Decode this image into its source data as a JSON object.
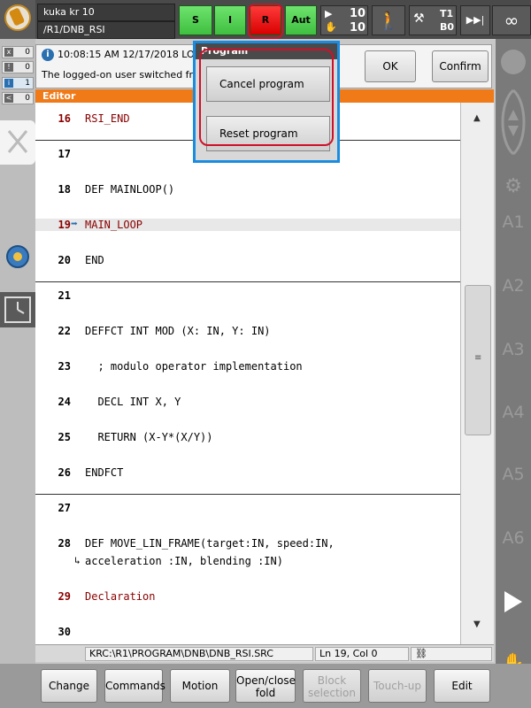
{
  "header": {
    "robot_name": "kuka kr 10",
    "path": "/R1/DNB_RSI",
    "status_buttons": [
      {
        "label": "S",
        "state": "green"
      },
      {
        "label": "I",
        "state": "green"
      },
      {
        "label": "R",
        "state": "red"
      },
      {
        "label": "Aut",
        "state": "green"
      }
    ],
    "override_prog": "10",
    "override_jog": "10",
    "tool_label": "T1",
    "base_label": "B0",
    "infinity": "∞"
  },
  "counters": [
    {
      "icon": "x",
      "value": "0"
    },
    {
      "icon": "!",
      "value": "0"
    },
    {
      "icon": "i",
      "value": "1"
    },
    {
      "icon": "<",
      "value": "0"
    }
  ],
  "message": {
    "time": "10:08:15 AM 12/17/2018 LO",
    "text": "The logged-on user switched fro",
    "ok_label": "OK",
    "confirm_all_label": "Confirm all"
  },
  "editor": {
    "title": "Editor",
    "lines": [
      {
        "num": "16",
        "code": "RSI_END",
        "style": "red"
      },
      {
        "num": "17",
        "code": "",
        "style": "plain"
      },
      {
        "num": "18",
        "code": "DEF MAINLOOP()",
        "style": "plain"
      },
      {
        "num": "19",
        "code": "MAIN_LOOP",
        "style": "red"
      },
      {
        "num": "20",
        "code": "END",
        "style": "plain"
      },
      {
        "num": "21",
        "code": "",
        "style": "plain"
      },
      {
        "num": "22",
        "code": "DEFFCT INT MOD (X: IN, Y: IN)",
        "style": "plain"
      },
      {
        "num": "23",
        "code": "  ; modulo operator implementation",
        "style": "plain"
      },
      {
        "num": "24",
        "code": "  DECL INT X, Y",
        "style": "plain"
      },
      {
        "num": "25",
        "code": "  RETURN (X-Y*(X/Y))",
        "style": "plain"
      },
      {
        "num": "26",
        "code": "ENDFCT",
        "style": "plain"
      },
      {
        "num": "27",
        "code": "",
        "style": "plain"
      },
      {
        "num": "28",
        "code": "DEF MOVE_LIN_FRAME(target:IN, speed:IN,",
        "style": "plain"
      },
      {
        "num": "",
        "code": "acceleration :IN, blending :IN)",
        "style": "plain"
      },
      {
        "num": "29",
        "code": "Declaration",
        "style": "red"
      },
      {
        "num": "30",
        "code": "",
        "style": "plain"
      }
    ]
  },
  "statusbar": {
    "file_path": "KRC:\\R1\\PROGRAM\\DNB\\DNB_RSI.SRC",
    "cursor_pos": "Ln 19, Col 0"
  },
  "right_axes": [
    "A1",
    "A2",
    "A3",
    "A4",
    "A5",
    "A6"
  ],
  "softkeys": [
    {
      "label": "Change",
      "enabled": true
    },
    {
      "label": "Commands",
      "enabled": true
    },
    {
      "label": "Motion",
      "enabled": true
    },
    {
      "label": "Open/close fold",
      "enabled": true
    },
    {
      "label": "Block selection",
      "enabled": false
    },
    {
      "label": "Touch-up",
      "enabled": false
    },
    {
      "label": "Edit",
      "enabled": true
    }
  ],
  "popup": {
    "title": "Program",
    "cancel_label": "Cancel program",
    "reset_label": "Reset program"
  },
  "colors": {
    "editor_bar": "#f07a18",
    "status_green": "#4fcf4f",
    "status_red": "#e00000",
    "highlight_ring": "#d0102a",
    "popup_border": "#1a8ce0"
  }
}
